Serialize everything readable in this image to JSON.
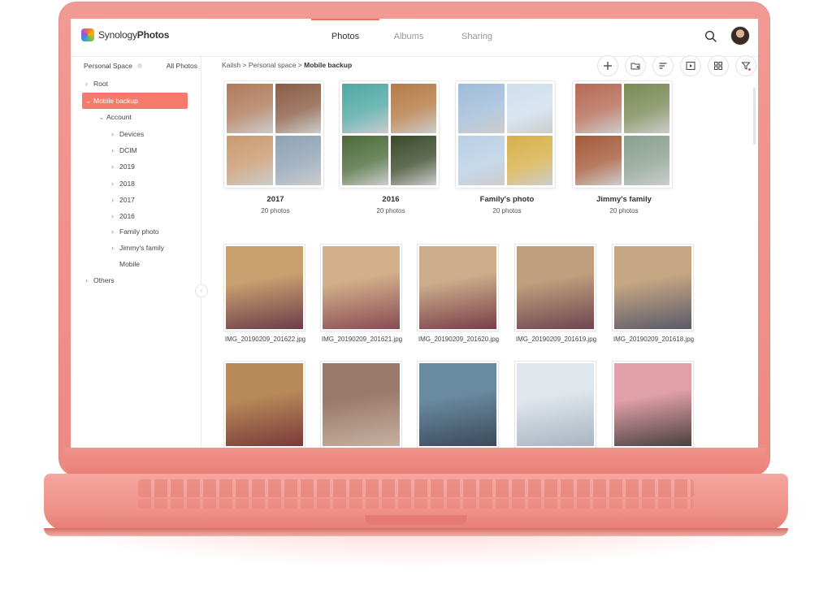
{
  "app": {
    "logo_word1": "Synology",
    "logo_word2": "Photos"
  },
  "tabs": [
    {
      "label": "Photos",
      "active": true
    },
    {
      "label": "Albums",
      "active": false
    },
    {
      "label": "Sharing",
      "active": false
    }
  ],
  "sidebar": {
    "space_label": "Personal Space",
    "all_photos_label": "All Photos",
    "items": [
      {
        "label": "Root",
        "chevron": "›"
      },
      {
        "label": "Mobile backup",
        "chevron": "⌄"
      },
      {
        "label": "Account",
        "chevron": "⌄"
      },
      {
        "label": "Devices",
        "chevron": "›"
      },
      {
        "label": "DCIM",
        "chevron": "›"
      },
      {
        "label": "2019",
        "chevron": "›"
      },
      {
        "label": "2018",
        "chevron": "›"
      },
      {
        "label": "2017",
        "chevron": "›"
      },
      {
        "label": "2016",
        "chevron": "›"
      },
      {
        "label": "Family photo",
        "chevron": "›"
      },
      {
        "label": "Jimmy's family",
        "chevron": "›"
      },
      {
        "label": "Mobile",
        "chevron": ""
      },
      {
        "label": "Others",
        "chevron": "›"
      }
    ],
    "collapse_glyph": "‹"
  },
  "breadcrumb": {
    "path": "Kailsh > Personal space > ",
    "current": "Mobile backup"
  },
  "toolbar": {
    "icons": [
      "plus-icon",
      "add-folder-icon",
      "sort-icon",
      "slideshow-icon",
      "grid-view-icon",
      "filter-icon"
    ]
  },
  "albums": [
    {
      "title": "2017",
      "count": "20 photos",
      "colors": [
        "#b07a5a",
        "#8a5d45",
        "#c99a70",
        "#8fa2b5"
      ]
    },
    {
      "title": "2016",
      "count": "20 photos",
      "colors": [
        "#4fa8a5",
        "#b57a45",
        "#4b6b3a",
        "#3b4a2a"
      ]
    },
    {
      "title": "Family's photo",
      "count": "20 photos",
      "colors": [
        "#9fbcd8",
        "#cfdfee",
        "#b8d0e4",
        "#d8b04a"
      ]
    },
    {
      "title": "Jimmy's family",
      "count": "20 photos",
      "colors": [
        "#b56a55",
        "#7a8a55",
        "#a55a3a",
        "#8aa090"
      ]
    }
  ],
  "photos": [
    {
      "name": "IMG_20190209_201622.jpg",
      "colors": [
        "#c9a070",
        "#6b3d4a"
      ]
    },
    {
      "name": "IMG_20190209_201621.jpg",
      "colors": [
        "#d2b08a",
        "#8a4a55"
      ]
    },
    {
      "name": "IMG_20190209_201620.jpg",
      "colors": [
        "#ccae8c",
        "#7a3d4a"
      ]
    },
    {
      "name": "IMG_20190209_201619.jpg",
      "colors": [
        "#bfa07e",
        "#6d4550"
      ]
    },
    {
      "name": "IMG_20190209_201618.jpg",
      "colors": [
        "#c6a784",
        "#5a5a6a"
      ]
    },
    {
      "name": "",
      "colors": [
        "#b88a5a",
        "#7a3a3a"
      ]
    },
    {
      "name": "",
      "colors": [
        "#9a7a6a",
        "#c7b0a0"
      ]
    },
    {
      "name": "",
      "colors": [
        "#6a8aa0",
        "#3a4a5a"
      ]
    },
    {
      "name": "",
      "colors": [
        "#dfe6ec",
        "#a8b4c0"
      ]
    },
    {
      "name": "",
      "colors": [
        "#e0a0a8",
        "#4a4040"
      ]
    }
  ],
  "colors": {
    "accent": "#f47a6b",
    "laptop": "#ec8a83"
  }
}
